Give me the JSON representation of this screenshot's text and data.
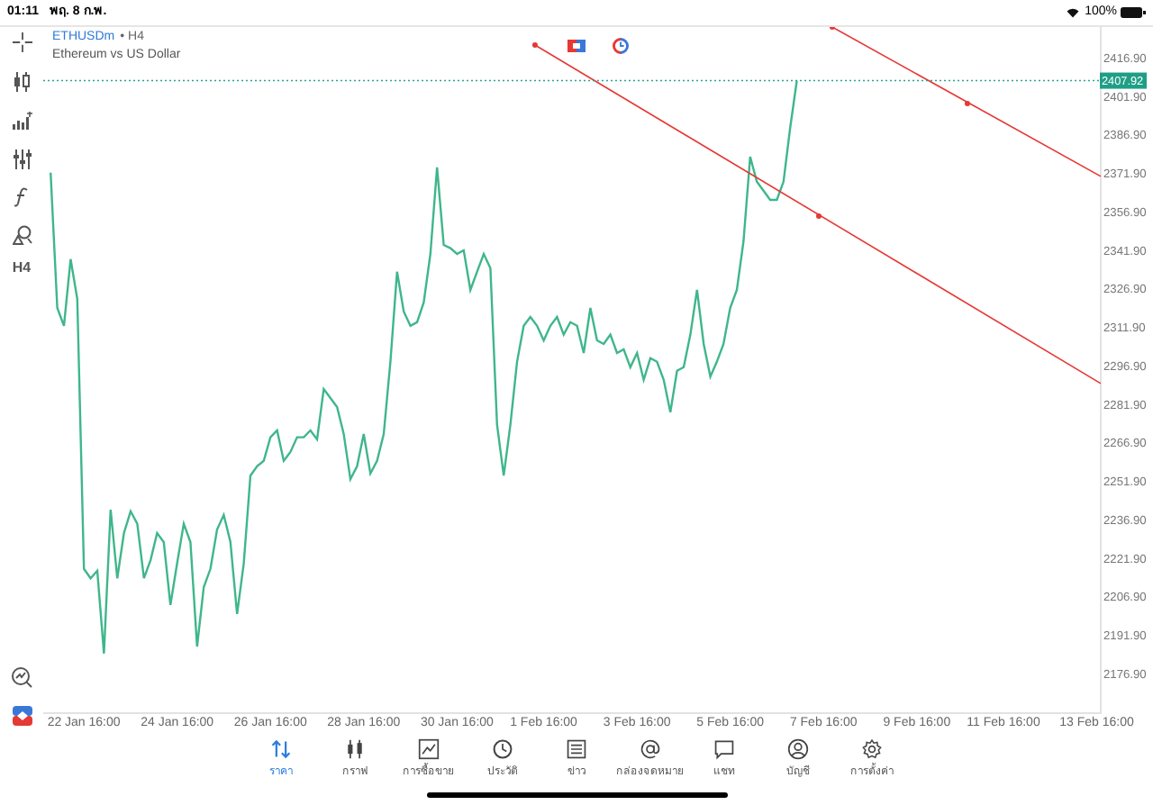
{
  "status_bar": {
    "time": "01:11",
    "date": "พฤ. 8 ก.พ.",
    "battery": "100%"
  },
  "chart_header": {
    "symbol": "ETHUSDm",
    "timeframe": "• H4",
    "description": "Ethereum vs US Dollar"
  },
  "toolbar": {
    "timeframe_button": "H4"
  },
  "chart": {
    "current_price": "2407.92",
    "chart_data": {
      "type": "line",
      "categories": [
        null,
        null,
        null,
        null,
        null,
        "22 Jan 16:00",
        null,
        null,
        null,
        null,
        null,
        null,
        null,
        null,
        null,
        null,
        null,
        null,
        null,
        "24 Jan 16:00",
        null,
        null,
        null,
        null,
        null,
        null,
        null,
        null,
        null,
        null,
        null,
        null,
        null,
        "26 Jan 16:00",
        null,
        null,
        null,
        null,
        null,
        null,
        null,
        null,
        null,
        null,
        null,
        null,
        null,
        "28 Jan 16:00",
        null,
        null,
        null,
        null,
        null,
        null,
        null,
        null,
        null,
        null,
        null,
        null,
        null,
        "30 Jan 16:00",
        null,
        null,
        null,
        null,
        null,
        null,
        null,
        null,
        null,
        null,
        null,
        null,
        "1 Feb 16:00",
        null,
        null,
        null,
        null,
        null,
        null,
        null,
        null,
        null,
        null,
        null,
        null,
        null,
        "3 Feb 16:00",
        null,
        null,
        null,
        null,
        null,
        null,
        null,
        null,
        null,
        null,
        null,
        null,
        null,
        "5 Feb 16:00",
        null,
        null,
        null,
        null,
        null,
        null,
        null,
        null,
        null,
        null,
        null,
        null,
        null,
        "7 Feb 16:00",
        null,
        null,
        null,
        null,
        null,
        null,
        null,
        null,
        null,
        null,
        null,
        null,
        null,
        "9 Feb 16:00",
        null,
        null,
        null,
        null,
        null,
        null,
        null,
        null,
        null,
        null,
        null,
        null,
        "11 Feb 16:00",
        null,
        null,
        null,
        null,
        null,
        null,
        null,
        null,
        null,
        null,
        null,
        null,
        null,
        "13 Feb 16:00",
        null
      ],
      "series": [
        {
          "color": "#3fb68b",
          "values": [
            2372.0,
            2319.3,
            2312.4,
            2338.3,
            2322.8,
            2217.6,
            2214.0,
            2216.9,
            2184.6,
            2240.7,
            2214.0,
            2231.6,
            2240.1,
            2235.2,
            2214.0,
            2221.1,
            2231.6,
            2228.1,
            2203.6,
            2219.7,
            2235.2,
            2228.1,
            2187.4,
            2210.5,
            2217.6,
            2233.0,
            2238.7,
            2228.1,
            2200.1,
            2219.7,
            2254.0,
            2257.6,
            2259.7,
            2268.9,
            2271.6,
            2259.7,
            2263.2,
            2268.9,
            2268.9,
            2271.6,
            2268.1,
            2287.7,
            2284.2,
            2280.7,
            2270.2,
            2252.6,
            2257.6,
            2270.2,
            2254.8,
            2259.7,
            2270.2,
            2298.3,
            2333.4,
            2317.9,
            2312.4,
            2313.8,
            2321.4,
            2340.4,
            2374.1,
            2343.9,
            2342.6,
            2340.4,
            2341.8,
            2326.3,
            2333.4,
            2340.4,
            2334.8,
            2273.8,
            2254.0,
            2273.8,
            2298.3,
            2312.4,
            2315.8,
            2312.4,
            2306.7,
            2312.4,
            2315.8,
            2308.9,
            2313.8,
            2312.4,
            2301.8,
            2319.3,
            2306.7,
            2305.3,
            2308.9,
            2301.8,
            2303.2,
            2296.2,
            2301.8,
            2291.3,
            2299.7,
            2298.3,
            2291.3,
            2278.7,
            2294.8,
            2296.2,
            2308.9,
            2326.3,
            2305.3,
            2292.6,
            2298.3,
            2305.3,
            2319.3,
            2326.3,
            2345.3,
            2378.3,
            2368.5,
            2365.0,
            2361.4,
            2361.4,
            2368.5,
            2389.5,
            2407.9,
            null,
            null,
            null,
            null,
            null,
            null,
            null,
            null,
            null,
            null,
            null,
            null,
            null,
            null,
            null,
            null,
            null,
            null,
            null,
            null,
            null,
            null,
            null,
            null,
            null,
            null,
            null,
            null,
            null,
            null,
            null,
            null,
            null,
            null,
            null,
            null,
            null,
            null,
            null,
            null,
            null,
            null,
            null,
            null,
            null,
            null
          ]
        }
      ],
      "ylim": [
        2161.4,
        2428.8
      ],
      "yticks": [
        {
          "value": 2416.9,
          "label": "2416.90"
        },
        {
          "value": 2401.9,
          "label": "2401.90"
        },
        {
          "value": 2386.9,
          "label": "2386.90"
        },
        {
          "value": 2371.9,
          "label": "2371.90"
        },
        {
          "value": 2356.9,
          "label": "2356.90"
        },
        {
          "value": 2341.9,
          "label": "2341.90"
        },
        {
          "value": 2326.9,
          "label": "2326.90"
        },
        {
          "value": 2311.9,
          "label": "2311.90"
        },
        {
          "value": 2296.9,
          "label": "2296.90"
        },
        {
          "value": 2281.9,
          "label": "2281.90"
        },
        {
          "value": 2266.9,
          "label": "2266.90"
        },
        {
          "value": 2251.9,
          "label": "2251.90"
        },
        {
          "value": 2236.9,
          "label": "2236.90"
        },
        {
          "value": 2221.9,
          "label": "2221.90"
        },
        {
          "value": 2206.9,
          "label": "2206.90"
        },
        {
          "value": 2191.9,
          "label": "2191.90"
        },
        {
          "value": 2176.9,
          "label": "2176.90"
        }
      ]
    }
  },
  "bottom_nav": [
    {
      "label": "ราคา",
      "selected": true
    },
    {
      "label": "กราฟ",
      "selected": false
    },
    {
      "label": "การซื้อขาย",
      "selected": false
    },
    {
      "label": "ประวัติ",
      "selected": false
    },
    {
      "label": "ข่าว",
      "selected": false
    },
    {
      "label": "กล่องจดหมาย",
      "selected": false
    },
    {
      "label": "แชท",
      "selected": false
    },
    {
      "label": "บัญชี",
      "selected": false
    },
    {
      "label": "การตั้งค่า",
      "selected": false
    }
  ]
}
